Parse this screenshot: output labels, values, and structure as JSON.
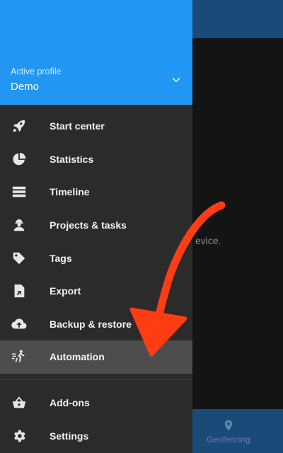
{
  "background": {
    "hint_text": "evice.",
    "bottom_tab": {
      "label": "Geofencing",
      "icon": "location-pin-icon"
    }
  },
  "drawer": {
    "header": {
      "label": "Active profile",
      "value": "Demo"
    },
    "items": [
      {
        "label": "Start center",
        "icon": "rocket-icon"
      },
      {
        "label": "Statistics",
        "icon": "pie-chart-icon"
      },
      {
        "label": "Timeline",
        "icon": "timeline-icon"
      },
      {
        "label": "Projects & tasks",
        "icon": "worker-icon"
      },
      {
        "label": "Tags",
        "icon": "tag-icon"
      },
      {
        "label": "Export",
        "icon": "export-icon"
      },
      {
        "label": "Backup & restore",
        "icon": "cloud-upload-icon"
      },
      {
        "label": "Automation",
        "icon": "running-person-icon",
        "active": true
      }
    ],
    "items_secondary": [
      {
        "label": "Add-ons",
        "icon": "basket-icon"
      },
      {
        "label": "Settings",
        "icon": "gear-icon"
      }
    ]
  },
  "colors": {
    "header": "#2196f3",
    "drawer_bg": "#2b2b2b",
    "active_item": "#4d4d4d",
    "annotation_arrow": "#ff3d14"
  }
}
